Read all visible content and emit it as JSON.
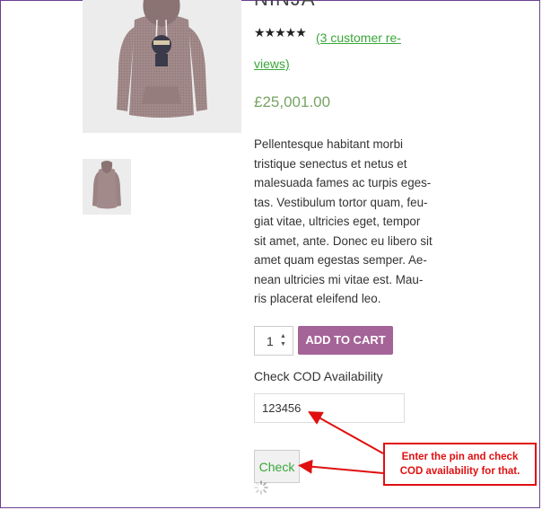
{
  "product": {
    "title": "NINJA",
    "rating_stars": "★★★★★",
    "reviews_line1": "(3 customer re-",
    "reviews_line2": "views)",
    "price": "£25,001.00",
    "description_lines": [
      "Pellentesque habitant morbi",
      "tristique senectus et netus et",
      "malesuada fames ac turpis eges-",
      "tas. Vestibulum tortor quam, feu-",
      "giat vitae, ultricies eget, tempor",
      "sit amet, ante. Donec eu libero sit",
      "amet quam egestas semper. Ae-",
      "nean ultricies mi vitae est. Mau-",
      "ris placerat eleifend leo."
    ]
  },
  "cart": {
    "quantity": "1",
    "add_to_cart_label": "ADD TO CART"
  },
  "cod": {
    "label": "Check COD Availability",
    "pin_value": "123456",
    "check_label": "Check"
  },
  "annotation": {
    "line1": "Enter the pin and check",
    "line2": "COD availability for that."
  },
  "colors": {
    "accent": "#a46497",
    "price": "#77a464",
    "link": "#3aa63a",
    "annotation": "#e01010"
  }
}
